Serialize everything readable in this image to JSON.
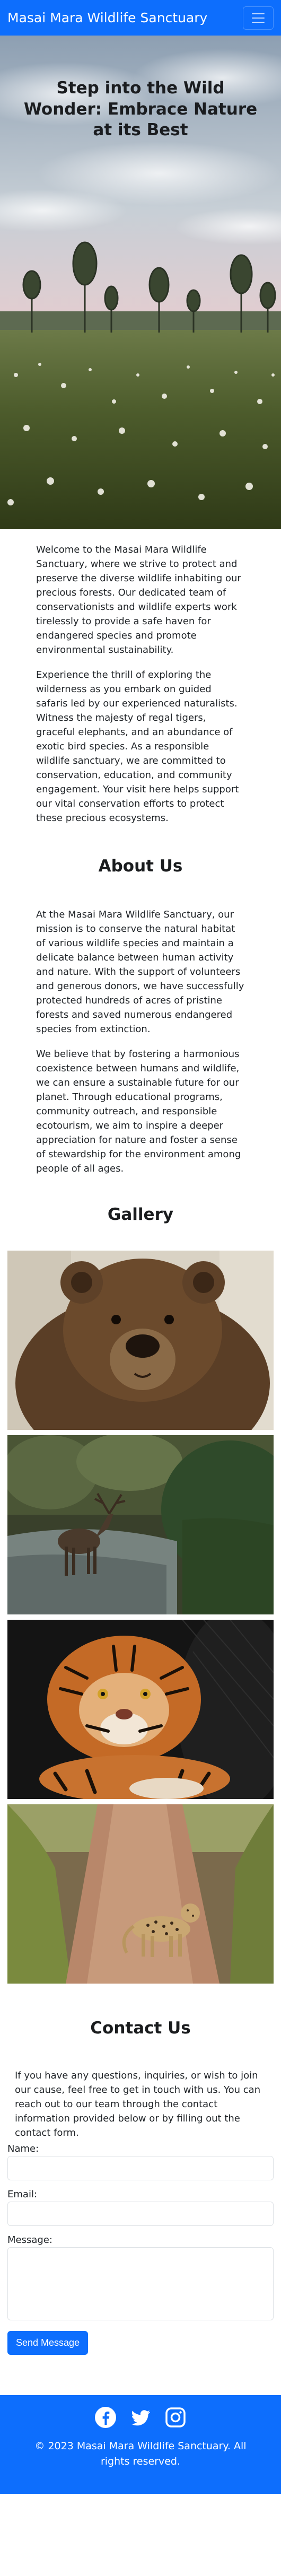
{
  "navbar": {
    "brand": "Masai Mara Wildlife Sanctuary",
    "toggler_icon": "hamburger-menu-icon"
  },
  "hero": {
    "title": "Step into the Wild Wonder: Embrace Nature at its Best"
  },
  "intro": {
    "paragraphs": [
      "Welcome to the Masai Mara Wildlife Sanctuary, where we strive to protect and preserve the diverse wildlife inhabiting our precious forests. Our dedicated team of conservationists and wildlife experts work tirelessly to provide a safe haven for endangered species and promote environmental sustainability.",
      "Experience the thrill of exploring the wilderness as you embark on guided safaris led by our experienced naturalists. Witness the majesty of regal tigers, graceful elephants, and an abundance of exotic bird species. As a responsible wildlife sanctuary, we are committed to conservation, education, and community engagement. Your visit here helps support our vital conservation efforts to protect these precious ecosystems."
    ]
  },
  "about": {
    "title": "About Us",
    "paragraphs": [
      "At the Masai Mara Wildlife Sanctuary, our mission is to conserve the natural habitat of various wildlife species and maintain a delicate balance between human activity and nature. With the support of volunteers and generous donors, we have successfully protected hundreds of acres of pristine forests and saved numerous endangered species from extinction.",
      "We believe that by fostering a harmonious coexistence between humans and wildlife, we can ensure a sustainable future for our planet. Through educational programs, community outreach, and responsible ecotourism, we aim to inspire a deeper appreciation for nature and foster a sense of stewardship for the environment among people of all ages."
    ]
  },
  "gallery": {
    "title": "Gallery",
    "images": [
      "bear-photo",
      "elk-photo",
      "tiger-photo",
      "leopard-photo"
    ]
  },
  "contact": {
    "title": "Contact Us",
    "lead": "If you have any questions, inquiries, or wish to join our cause, feel free to get in touch with us. You can reach out to our team through the contact information provided below or by filling out the contact form.",
    "name_label": "Name:",
    "email_label": "Email:",
    "message_label": "Message:",
    "name_value": "",
    "email_value": "",
    "message_value": "",
    "send_label": "Send Message"
  },
  "footer": {
    "social_icons": [
      "facebook-icon",
      "twitter-icon",
      "instagram-icon"
    ],
    "copyright": "© 2023 Masai Mara Wildlife Sanctuary. All rights reserved."
  },
  "colors": {
    "primary": "#0d6efd",
    "text": "#212529",
    "white": "#ffffff"
  }
}
